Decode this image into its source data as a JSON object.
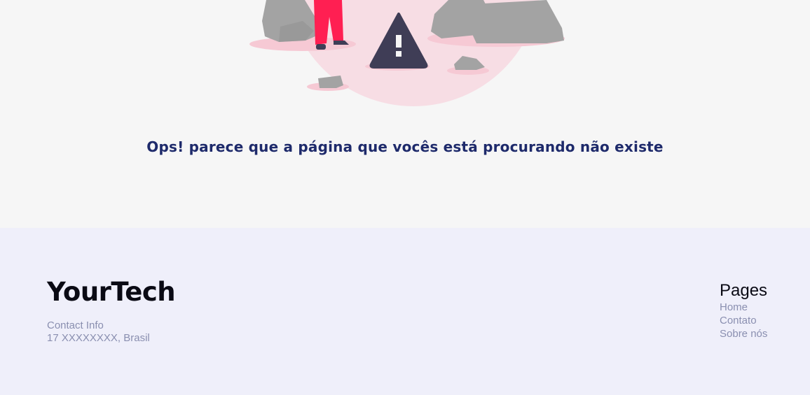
{
  "hero": {
    "message": "Ops! parece que a página que vocês está procurando não existe"
  },
  "footer": {
    "brand": "YourTech",
    "contact": {
      "title": "Contact Info",
      "address": "17 XXXXXXXX, Brasil"
    },
    "pages": {
      "title": "Pages",
      "links": [
        {
          "label": "Home"
        },
        {
          "label": "Contato"
        },
        {
          "label": "Sobre nós"
        }
      ]
    }
  },
  "colors": {
    "heading": "#1e2a6b",
    "muted_text": "#8a8fb0",
    "footer_bg": "#efeffa",
    "page_bg": "#f6f6f6",
    "accent_pink": "#f7dde4",
    "person_red": "#ff1f52",
    "warning_dark": "#3f3d56",
    "rock_gray": "#a3a3a3"
  },
  "icons": {
    "warning": "warning-triangle-icon"
  }
}
